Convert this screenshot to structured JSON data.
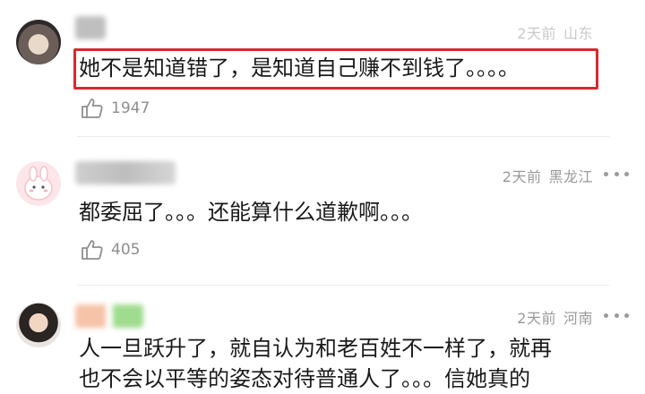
{
  "comments": [
    {
      "time": "2天前",
      "location": "山东",
      "text": "她不是知道错了，是知道自己赚不到钱了。。。。",
      "likes": "1947"
    },
    {
      "time": "2天前",
      "location": "黑龙江",
      "text": "都委屈了。。。还能算什么道歉啊。。。",
      "likes": "405"
    },
    {
      "time": "2天前",
      "location": "河南",
      "text_line1": "人一旦跃升了，就自认为和老百姓不一样了，就再",
      "text_line2": "也不会以平等的姿态对待普通人了。。。信她真的"
    }
  ],
  "icons": {
    "like": "thumbs-up-icon",
    "more": "more-dots-icon"
  },
  "colors": {
    "highlight": "#d8282f",
    "meta": "#9a9a9a"
  }
}
